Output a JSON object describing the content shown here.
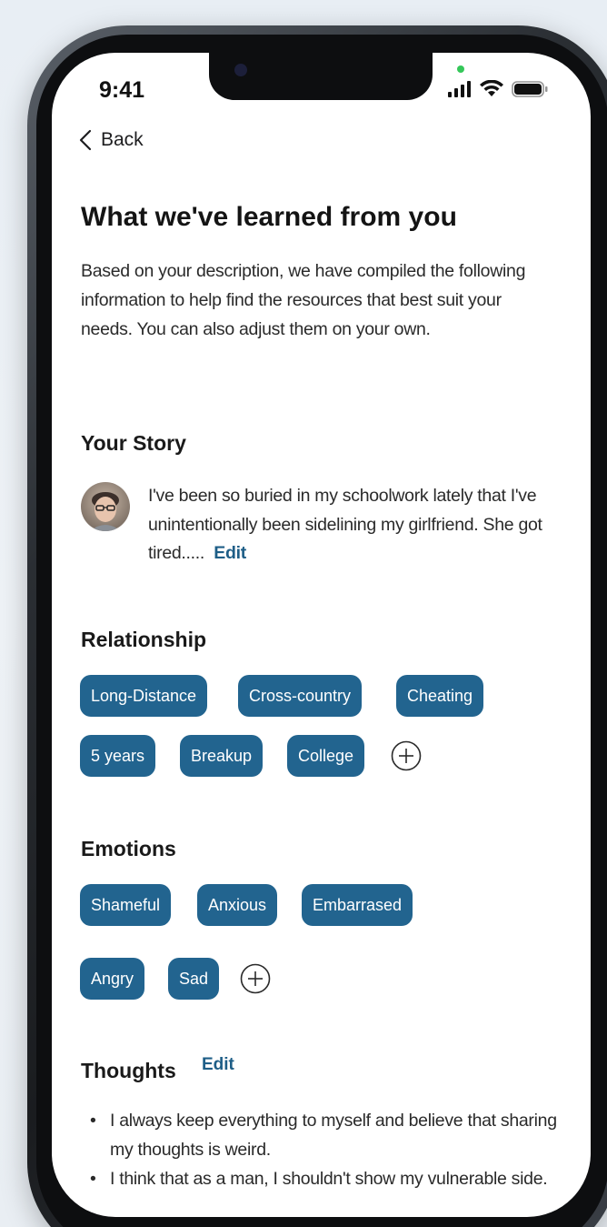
{
  "status_bar": {
    "time": "9:41"
  },
  "nav": {
    "back_label": "Back"
  },
  "header": {
    "title": "What we've learned from you",
    "intro": "Based on your description, we have compiled the following information to help find the resources that best suit your needs. You can also adjust them on your own."
  },
  "story": {
    "heading": "Your Story",
    "text": "I've been so buried in my schoolwork lately that I've unintentionally been sidelining my girlfriend. She got tired.....",
    "edit_label": "Edit"
  },
  "relationship": {
    "heading": "Relationship",
    "chips": [
      "Long-Distance",
      "Cross-country",
      "Cheating",
      "5 years",
      "Breakup",
      "College"
    ]
  },
  "emotions": {
    "heading": "Emotions",
    "chips": [
      "Shameful",
      "Anxious",
      "Embarrased",
      "Angry",
      "Sad"
    ]
  },
  "thoughts": {
    "heading": "Thoughts",
    "edit_label": "Edit",
    "items": [
      "I always keep everything to myself and believe that sharing my thoughts is weird.",
      "I think that as a man, I shouldn't show my vulnerable side."
    ]
  },
  "colors": {
    "chip_bg": "#22648f",
    "link": "#1e5e87",
    "status_dot": "#35c759"
  }
}
